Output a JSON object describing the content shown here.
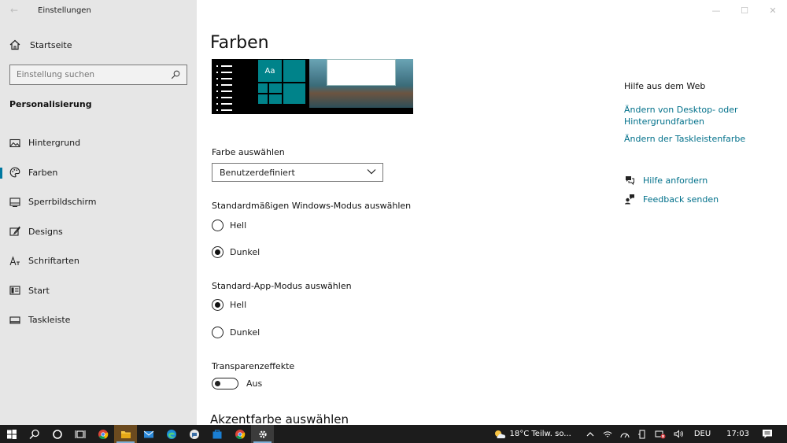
{
  "window": {
    "app_title": "Einstellungen",
    "back_glyph": "←",
    "controls": [
      "—",
      "☐",
      "✕"
    ]
  },
  "sidebar": {
    "home_label": "Startseite",
    "search_placeholder": "Einstellung suchen",
    "section_title": "Personalisierung",
    "items": [
      {
        "label": "Hintergrund",
        "icon": "picture-icon"
      },
      {
        "label": "Farben",
        "icon": "palette-icon",
        "active": true
      },
      {
        "label": "Sperrbildschirm",
        "icon": "lockscreen-icon"
      },
      {
        "label": "Designs",
        "icon": "brush-icon"
      },
      {
        "label": "Schriftarten",
        "icon": "font-icon"
      },
      {
        "label": "Start",
        "icon": "start-icon"
      },
      {
        "label": "Taskleiste",
        "icon": "taskbar-icon"
      }
    ]
  },
  "main": {
    "title": "Farben",
    "preview_tile_text": "Aa",
    "color_select": {
      "label": "Farbe auswählen",
      "value": "Benutzerdefiniert"
    },
    "windows_mode": {
      "label": "Standardmäßigen Windows-Modus auswählen",
      "options": [
        "Hell",
        "Dunkel"
      ],
      "selected": "Dunkel"
    },
    "app_mode": {
      "label": "Standard-App-Modus auswählen",
      "options": [
        "Hell",
        "Dunkel"
      ],
      "selected": "Hell"
    },
    "transparency": {
      "label": "Transparenzeffekte",
      "state": "Aus"
    },
    "accent_title": "Akzentfarbe auswählen"
  },
  "help": {
    "title": "Hilfe aus dem Web",
    "links": [
      "Ändern von Desktop- oder Hintergrundfarben",
      "Ändern der Taskleistenfarbe"
    ],
    "actions": [
      {
        "label": "Hilfe anfordern",
        "icon": "help-chat-icon"
      },
      {
        "label": "Feedback senden",
        "icon": "feedback-icon"
      }
    ]
  },
  "taskbar": {
    "weather": "18°C Teilw. so...",
    "language": "DEU",
    "time": "17:03",
    "accent": "#0078a0"
  }
}
